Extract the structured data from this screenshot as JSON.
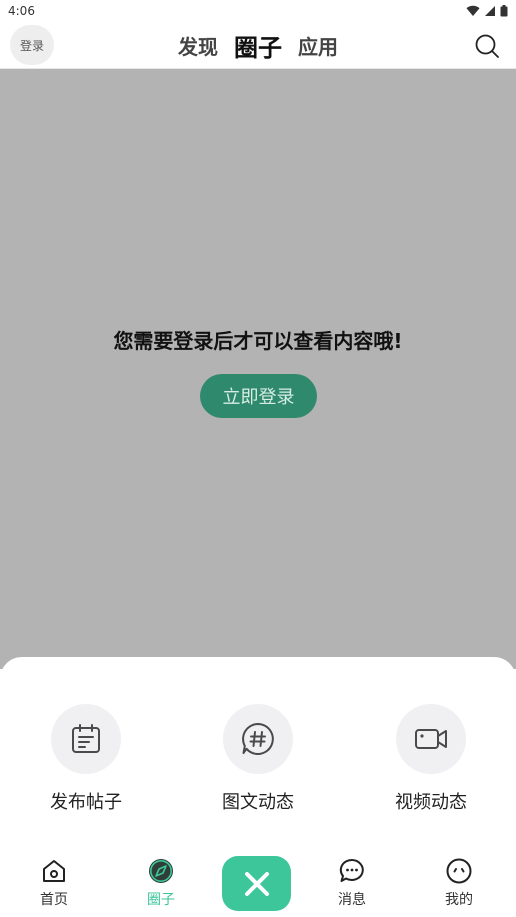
{
  "status_bar": {
    "time": "4:06"
  },
  "header": {
    "login_label": "登录",
    "tabs": [
      {
        "label": "发现"
      },
      {
        "label": "圈子"
      },
      {
        "label": "应用"
      }
    ]
  },
  "overlay": {
    "prompt": "您需要登录后才可以查看内容哦!",
    "login_button": "立即登录"
  },
  "sheet": {
    "actions": [
      {
        "label": "发布帖子",
        "icon": "post-icon"
      },
      {
        "label": "图文动态",
        "icon": "hashtag-icon"
      },
      {
        "label": "视频动态",
        "icon": "video-icon"
      }
    ]
  },
  "nav": {
    "items": [
      {
        "label": "首页",
        "icon": "home-icon"
      },
      {
        "label": "圈子",
        "icon": "compass-icon"
      },
      {
        "label": "消息",
        "icon": "chat-icon"
      },
      {
        "label": "我的",
        "icon": "profile-icon"
      }
    ],
    "accent": "#3cc69a"
  },
  "colors": {
    "overlay": "#b3b3b3",
    "button": "#2f8a6d"
  }
}
